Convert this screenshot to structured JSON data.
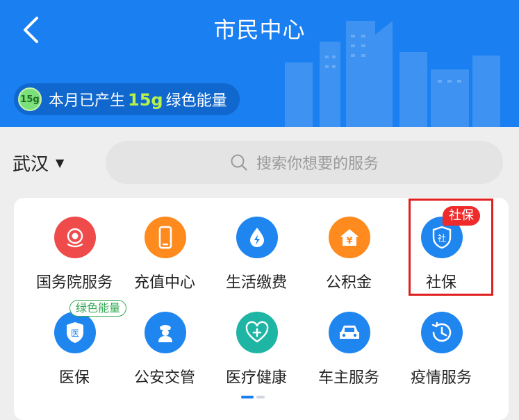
{
  "header": {
    "title": "市民中心",
    "back_icon": "chevron-left-icon",
    "background_color": "#1a7ff0"
  },
  "energy": {
    "badge": "15g",
    "prefix": "本月已产生",
    "value": "15g",
    "suffix": "绿色能量"
  },
  "location": {
    "city": "武汉",
    "caret_icon": "caret-down-icon"
  },
  "search": {
    "placeholder": "搜索你想要的服务",
    "icon": "search-icon"
  },
  "services": {
    "row1": [
      {
        "label": "国务院服务",
        "icon": "gov-emblem-icon",
        "color": "#ef4b4b"
      },
      {
        "label": "充值中心",
        "icon": "phone-icon",
        "color": "#ff8a1e"
      },
      {
        "label": "生活缴费",
        "icon": "water-drop-icon",
        "color": "#1f86f0"
      },
      {
        "label": "公积金",
        "icon": "house-yuan-icon",
        "color": "#ff8a1e"
      },
      {
        "label": "社保",
        "icon": "shield-she-icon",
        "glyph": "社",
        "color": "#1f86f0",
        "tag": "社保"
      }
    ],
    "row2": [
      {
        "label": "医保",
        "icon": "shield-yi-icon",
        "glyph": "医",
        "color": "#1f86f0",
        "tag": "绿色能量"
      },
      {
        "label": "公安交管",
        "icon": "police-icon",
        "color": "#1f86f0"
      },
      {
        "label": "医疗健康",
        "icon": "heart-plus-icon",
        "color": "#1fb5a4"
      },
      {
        "label": "车主服务",
        "icon": "car-icon",
        "color": "#1f86f0"
      },
      {
        "label": "疫情服务",
        "icon": "clock-history-icon",
        "color": "#1f86f0"
      }
    ]
  },
  "colors": {
    "accent": "#1a7ff0",
    "highlight_border": "#e02020",
    "tag_red": "#ee2a2a",
    "tag_green": "#34a853"
  }
}
